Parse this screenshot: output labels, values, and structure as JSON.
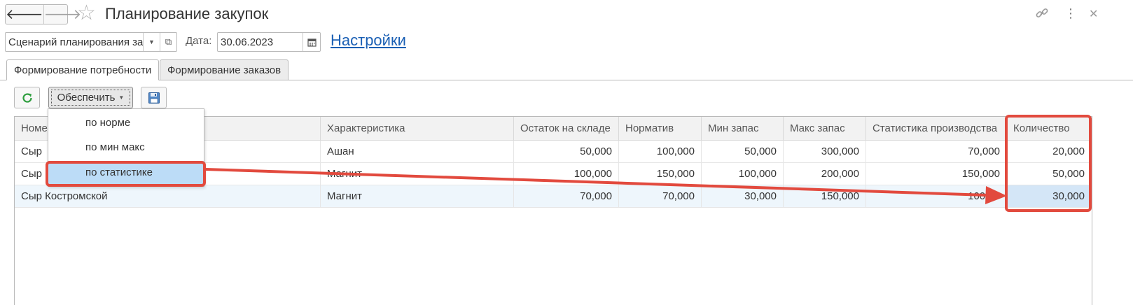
{
  "window": {
    "title": "Планирование закупок",
    "nav_back_icon": "arrow-left-icon",
    "nav_forward_icon": "arrow-right-icon",
    "favorite_icon": "star-icon",
    "link_icon": "link-icon",
    "more_icon": "more-vertical-icon",
    "close_icon": "close-icon"
  },
  "filters": {
    "scenario_value": "Сценарий планирования за",
    "date_label": "Дата:",
    "date_value": "30.06.2023",
    "settings_link": "Настройки"
  },
  "tabs": [
    {
      "label": "Формирование потребности",
      "active": true
    },
    {
      "label": "Формирование заказов",
      "active": false
    }
  ],
  "toolbar": {
    "refresh_icon": "refresh-icon",
    "provide_label": "Обеспечить",
    "save_icon": "save-icon"
  },
  "menu": {
    "items": [
      {
        "label": "по норме"
      },
      {
        "label": "по мин макс"
      },
      {
        "label": "по статистике",
        "highlighted": true
      }
    ]
  },
  "table": {
    "columns": [
      "Номе",
      "Характеристика",
      "Остаток на складе",
      "Норматив",
      "Мин запас",
      "Макс запас",
      "Статистика производства",
      "Количество"
    ],
    "rows": [
      {
        "name": "Сыр",
        "characteristic": "Ашан",
        "stock": "50,000",
        "norm": "100,000",
        "min": "50,000",
        "max": "300,000",
        "stat": "70,000",
        "qty": "20,000"
      },
      {
        "name": "Сыр",
        "characteristic": "Магнит",
        "stock": "100,000",
        "norm": "150,000",
        "min": "100,000",
        "max": "200,000",
        "stat": "150,000",
        "qty": "50,000"
      },
      {
        "name": "Сыр Костромской",
        "characteristic": "Магнит",
        "stock": "70,000",
        "norm": "70,000",
        "min": "30,000",
        "max": "150,000",
        "stat": "100,00",
        "qty": "30,000",
        "selected": true
      }
    ]
  },
  "annotation": {
    "color": "#e24a3e"
  },
  "colors": {
    "link": "#1a5fb4",
    "accent_green": "#2e9e3e",
    "menu_highlight": "#bcdcf7"
  }
}
